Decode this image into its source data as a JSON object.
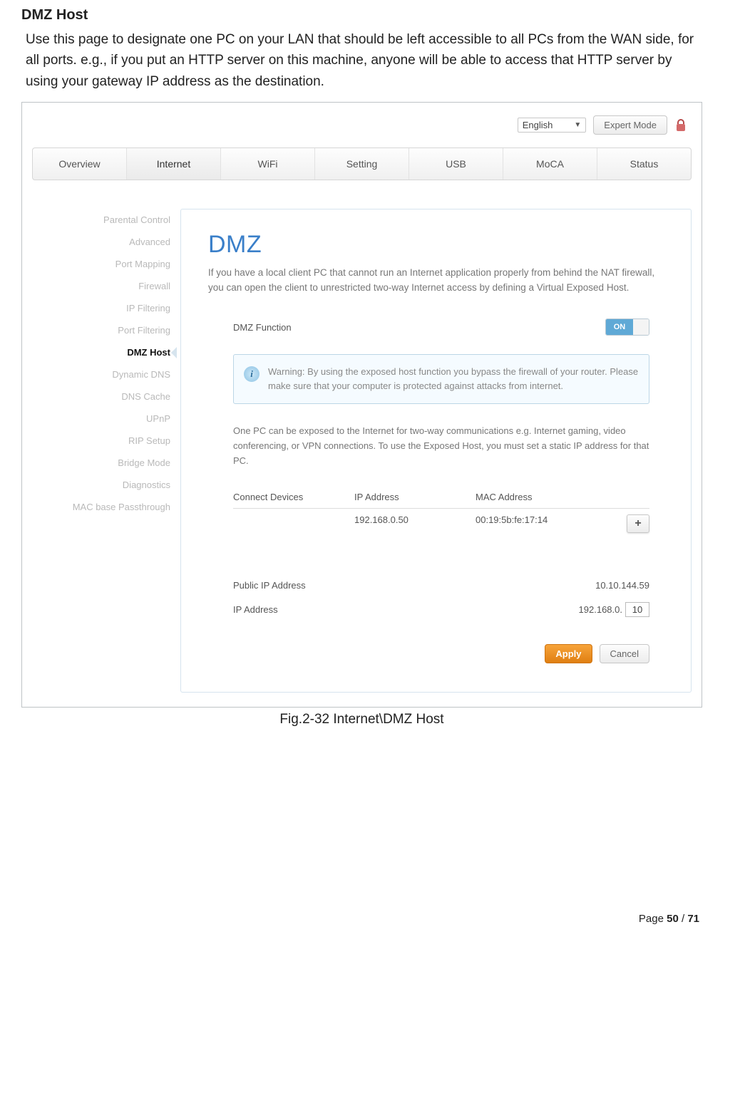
{
  "doc": {
    "section_title": "DMZ Host",
    "section_intro": "Use this page to designate one PC on your LAN that should be left accessible to all PCs from the WAN side, for all ports. e.g., if you put an HTTP server on this machine, anyone will be able to access that HTTP server by using your gateway IP address as the destination.",
    "figure_caption": "Fig.2-32 Internet\\DMZ Host",
    "page_label": "Page ",
    "page_current": "50",
    "page_sep": " / ",
    "page_total": "71"
  },
  "topbar": {
    "language": "English",
    "expert_btn": "Expert Mode"
  },
  "tabs": [
    "Overview",
    "Internet",
    "WiFi",
    "Setting",
    "USB",
    "MoCA",
    "Status"
  ],
  "tabs_active_index": 1,
  "sidenav": [
    "Parental Control",
    "Advanced",
    "Port Mapping",
    "Firewall",
    "IP Filtering",
    "Port Filtering",
    "DMZ Host",
    "Dynamic DNS",
    "DNS Cache",
    "UPnP",
    "RIP Setup",
    "Bridge Mode",
    "Diagnostics",
    "MAC base Passthrough"
  ],
  "sidenav_active_index": 6,
  "panel": {
    "title": "DMZ",
    "intro": "If you have a local client PC that cannot run an Internet application properly from behind the NAT firewall, you can open the client to unrestricted two-way Internet access by defining a Virtual Exposed Host.",
    "dmz_function_label": "DMZ Function",
    "toggle_state": "ON",
    "warning": "Warning: By using the exposed host function you bypass the firewall of your router. Please make sure that your computer is protected against attacks from internet.",
    "desc2": "One PC can be exposed to the Internet for two-way communications e.g. Internet gaming, video conferencing, or VPN connections. To use the Exposed Host, you must set a static IP address for that PC.",
    "table": {
      "headers": {
        "c1": "Connect Devices",
        "c2": "IP Address",
        "c3": "MAC Address"
      },
      "row": {
        "c1": "",
        "c2": "192.168.0.50",
        "c3": "00:19:5b:fe:17:14"
      }
    },
    "public_ip_label": "Public IP Address",
    "public_ip_value": "10.10.144.59",
    "ip_label": "IP Address",
    "ip_prefix": "192.168.0.",
    "ip_last_octet": "10",
    "apply": "Apply",
    "cancel": "Cancel"
  }
}
